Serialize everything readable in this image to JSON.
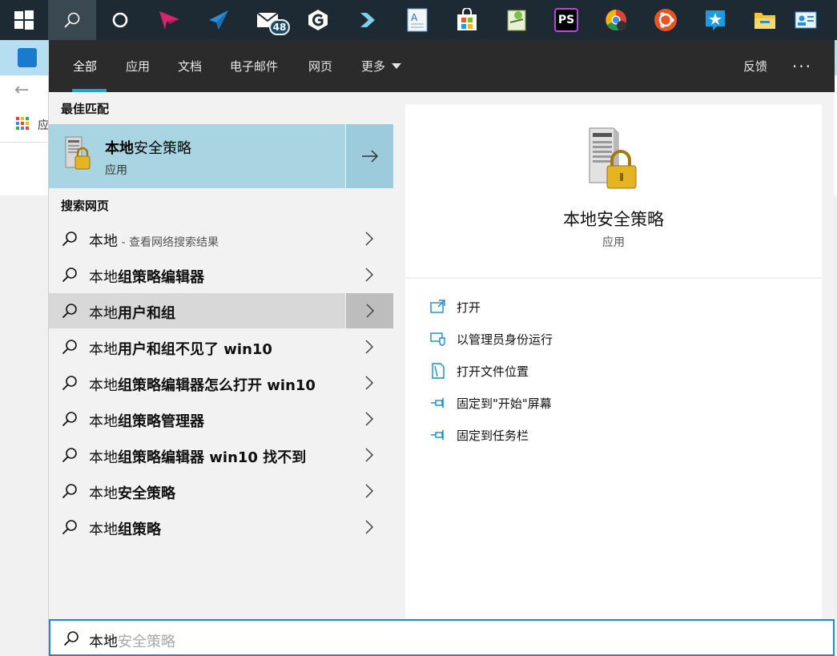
{
  "taskbar": {
    "mail_badge": "48",
    "photoshop_label": "PS"
  },
  "background": {
    "partial_label": "应"
  },
  "header": {
    "tabs": [
      {
        "label": "全部",
        "active": true
      },
      {
        "label": "应用",
        "active": false
      },
      {
        "label": "文档",
        "active": false
      },
      {
        "label": "电子邮件",
        "active": false
      },
      {
        "label": "网页",
        "active": false
      },
      {
        "label": "更多",
        "active": false
      }
    ],
    "feedback": "反馈",
    "more_options": "···"
  },
  "best_match": {
    "section_title": "最佳匹配",
    "title_bold": "本地",
    "title_rest": "安全策略",
    "subtitle": "应用"
  },
  "web_search": {
    "section_title": "搜索网页",
    "items": [
      {
        "prefix": "本地",
        "bold": "",
        "hint": " - 查看网络搜索结果"
      },
      {
        "prefix": "本地",
        "bold": "组策略编辑器",
        "hint": ""
      },
      {
        "prefix": "本地",
        "bold": "用户和组",
        "hint": ""
      },
      {
        "prefix": "本地",
        "bold": "用户和组不见了 win10",
        "hint": ""
      },
      {
        "prefix": "本地",
        "bold": "组策略编辑器怎么打开 win10",
        "hint": ""
      },
      {
        "prefix": "本地",
        "bold": "组策略管理器",
        "hint": ""
      },
      {
        "prefix": "本地",
        "bold": "组策略编辑器 win10 找不到",
        "hint": ""
      },
      {
        "prefix": "本地",
        "bold": "安全策略",
        "hint": ""
      },
      {
        "prefix": "本地",
        "bold": "组策略",
        "hint": ""
      }
    ]
  },
  "preview": {
    "title": "本地安全策略",
    "subtitle": "应用",
    "actions": [
      {
        "label": "打开",
        "icon": "open-icon"
      },
      {
        "label": "以管理员身份运行",
        "icon": "shield-icon"
      },
      {
        "label": "打开文件位置",
        "icon": "file-location-icon"
      },
      {
        "label": "固定到\"开始\"屏幕",
        "icon": "pin-icon"
      },
      {
        "label": "固定到任务栏",
        "icon": "pin-icon"
      }
    ]
  },
  "search": {
    "typed": "本地",
    "suggestion": "安全策略"
  },
  "colors": {
    "accent": "#1a8ccc",
    "taskbar": "#1d2a33",
    "header": "#2b2b2b",
    "best_match_bg": "#a9d5e3"
  }
}
